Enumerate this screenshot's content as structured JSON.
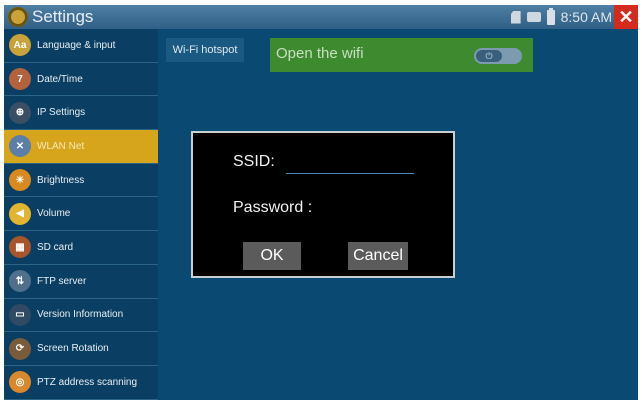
{
  "statusbar": {
    "title": "Settings",
    "time": "8:50 AM",
    "close_glyph": "✕",
    "icons": [
      "sd-card-icon",
      "power-plug-icon",
      "battery-icon"
    ]
  },
  "sidebar": {
    "items": [
      {
        "label": "Language & input",
        "icon": "language-icon",
        "icon_text": "Aa",
        "color": "#c9a23a",
        "active": false
      },
      {
        "label": "Date/Time",
        "icon": "calendar-icon",
        "icon_text": "7",
        "color": "#b3623d",
        "active": false
      },
      {
        "label": "IP Settings",
        "icon": "globe-icon",
        "icon_text": "⊕",
        "color": "#3a4f63",
        "active": false
      },
      {
        "label": "WLAN Net",
        "icon": "wrench-icon",
        "icon_text": "✕",
        "color": "#5b7fa8",
        "active": true
      },
      {
        "label": "Brightness",
        "icon": "brightness-icon",
        "icon_text": "☀",
        "color": "#d98a1e",
        "active": false
      },
      {
        "label": "Volume",
        "icon": "speaker-icon",
        "icon_text": "◀",
        "color": "#e1b530",
        "active": false
      },
      {
        "label": "SD card",
        "icon": "sd-card-icon",
        "icon_text": "▦",
        "color": "#a8552c",
        "active": false
      },
      {
        "label": "FTP server",
        "icon": "ftp-icon",
        "icon_text": "⇅",
        "color": "#4f6f8a",
        "active": false
      },
      {
        "label": "Version Information",
        "icon": "monitor-icon",
        "icon_text": "▭",
        "color": "#2f4a62",
        "active": false
      },
      {
        "label": "Screen Rotation",
        "icon": "rotation-icon",
        "icon_text": "⟳",
        "color": "#7a5b3b",
        "active": false
      },
      {
        "label": "PTZ address scanning",
        "icon": "scan-icon",
        "icon_text": "◎",
        "color": "#d9892b",
        "active": false
      }
    ]
  },
  "main": {
    "tab_label": "Wi-Fi hotspot",
    "wifi_label": "Open the wifi",
    "toggle_glyph": "⏻",
    "wifi_enabled": false
  },
  "dialog": {
    "ssid_label": "SSID:",
    "ssid_value": "",
    "password_label": "Password :",
    "ok_label": "OK",
    "cancel_label": "Cancel"
  }
}
